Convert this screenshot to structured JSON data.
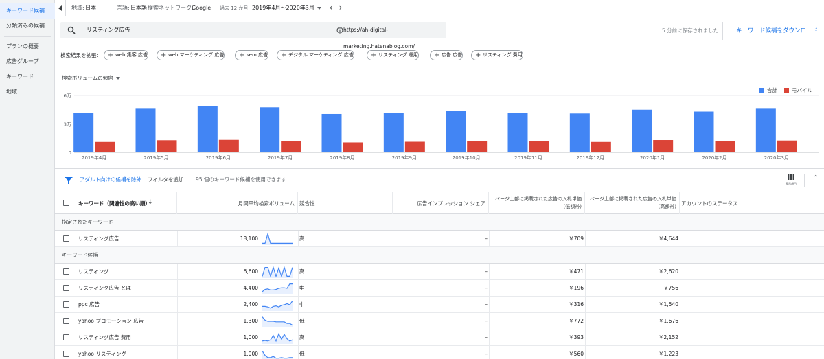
{
  "sidebar": {
    "items": [
      {
        "label": "キーワード候補",
        "active": true
      },
      {
        "label": "分類済みの候補",
        "active": false
      },
      {
        "label": "プランの概要",
        "active": false
      },
      {
        "label": "広告グループ",
        "active": false
      },
      {
        "label": "キーワード",
        "active": false
      },
      {
        "label": "地域",
        "active": false
      }
    ]
  },
  "topbar": {
    "location_label": "地域:",
    "location_value": "日本",
    "language_label": "言語:",
    "language_value": "日本語",
    "network_label": "検索ネットワーク:",
    "network_value": "Google",
    "period_label": "過去 12 か月",
    "period_value": "2019年4月～2020年3月"
  },
  "search": {
    "query": "リスティング広告",
    "url": "https://ah-digital-marketing.hatenablog.com/",
    "saved_text": "5 分前に保存されました",
    "download_label": "キーワード候補をダウンロード"
  },
  "expand": {
    "label": "検索結果を拡張:",
    "chips": [
      "web 集客 広告",
      "web マーケティング 広告",
      "sem 広告",
      "デジタル マーケティング 広告",
      "リスティング 運用",
      "広告 広告",
      "リスティング 費用"
    ]
  },
  "chart_data": {
    "type": "bar",
    "title": "検索ボリュームの傾向",
    "categories": [
      "2019年4月",
      "2019年5月",
      "2019年6月",
      "2019年7月",
      "2019年8月",
      "2019年9月",
      "2019年10月",
      "2019年11月",
      "2019年12月",
      "2020年1月",
      "2020年2月",
      "2020年3月"
    ],
    "series": [
      {
        "name": "合計",
        "color": "#4285f4",
        "values": [
          41500,
          46000,
          49000,
          47500,
          40500,
          41500,
          43500,
          41500,
          41000,
          45000,
          43000,
          46000
        ]
      },
      {
        "name": "モバイル",
        "color": "#db4437",
        "values": [
          11000,
          12800,
          13200,
          12200,
          10500,
          11200,
          12000,
          11800,
          11000,
          13000,
          12200,
          12500
        ]
      }
    ],
    "y_ticks": [
      "0",
      "3万",
      "6万"
    ],
    "ylim": [
      0,
      60000
    ],
    "grid": true,
    "legend_position": "top-right"
  },
  "filter_bar": {
    "exclude_adult": "アダルト向けの候補を除外",
    "add_filter": "フィルタを追加",
    "count_text": "95 個のキーワード候補を使用できます",
    "columns_label": "表示項目"
  },
  "table": {
    "headers": {
      "keyword": "キーワード（関連性の高い順）",
      "volume": "月間平均検索ボリューム",
      "competition": "競合性",
      "impression_share": "広告インプレッション シェア",
      "bid_low": [
        "ページ上部に掲載された広告の入札単価",
        "(低額帯)"
      ],
      "bid_high": [
        "ページ上部に掲載された広告の入札単価",
        "(高額帯)"
      ],
      "status": "アカウントのステータス"
    },
    "group_specified": "指定されたキーワード",
    "group_ideas": "キーワード候補",
    "specified_rows": [
      {
        "keyword": "リスティング広告",
        "volume": "18,100",
        "competition": "高",
        "share": "–",
        "bid_low": "￥709",
        "bid_high": "￥4,644",
        "trend": [
          0.1,
          0.1,
          0.95,
          0.1,
          0.1,
          0.1,
          0.1,
          0.1,
          0.1,
          0.1,
          0.1,
          0.1
        ]
      }
    ],
    "idea_rows": [
      {
        "keyword": "リスティング",
        "volume": "6,600",
        "competition": "高",
        "share": "–",
        "bid_low": "￥471",
        "bid_high": "￥2,620",
        "trend": [
          0.1,
          0.9,
          0.9,
          0.1,
          0.9,
          0.1,
          0.85,
          0.1,
          0.9,
          0.1,
          0.1,
          0.9
        ]
      },
      {
        "keyword": "リスティング広告 とは",
        "volume": "4,400",
        "competition": "中",
        "share": "–",
        "bid_low": "￥196",
        "bid_high": "￥756",
        "trend": [
          0.2,
          0.4,
          0.45,
          0.35,
          0.35,
          0.4,
          0.5,
          0.55,
          0.55,
          0.5,
          0.9,
          0.9
        ]
      },
      {
        "keyword": "ppc 広告",
        "volume": "2,400",
        "competition": "中",
        "share": "–",
        "bid_low": "￥316",
        "bid_high": "￥1,540",
        "trend": [
          0.35,
          0.35,
          0.3,
          0.2,
          0.35,
          0.4,
          0.3,
          0.45,
          0.5,
          0.6,
          0.5,
          0.85
        ]
      },
      {
        "keyword": "yahoo プロモーション 広告",
        "volume": "1,300",
        "competition": "低",
        "share": "–",
        "bid_low": "￥772",
        "bid_high": "￥1,676",
        "trend": [
          0.9,
          0.6,
          0.5,
          0.5,
          0.5,
          0.45,
          0.45,
          0.45,
          0.45,
          0.3,
          0.3,
          0.15
        ]
      },
      {
        "keyword": "リスティング広告 費用",
        "volume": "1,000",
        "competition": "高",
        "share": "–",
        "bid_low": "￥393",
        "bid_high": "￥2,152",
        "trend": [
          0.2,
          0.25,
          0.2,
          0.3,
          0.7,
          0.2,
          0.85,
          0.35,
          0.8,
          0.4,
          0.2,
          0.3
        ]
      },
      {
        "keyword": "yahoo リスティング",
        "volume": "1,000",
        "competition": "低",
        "share": "–",
        "bid_low": "￥560",
        "bid_high": "￥1,223",
        "trend": [
          0.8,
          0.4,
          0.2,
          0.2,
          0.3,
          0.15,
          0.15,
          0.2,
          0.15,
          0.15,
          0.2,
          0.2
        ]
      }
    ]
  },
  "colors": {
    "accent": "#1a73e8",
    "total_bar": "#4285f4",
    "mobile_bar": "#db4437",
    "sparkline": "#4285f4"
  }
}
